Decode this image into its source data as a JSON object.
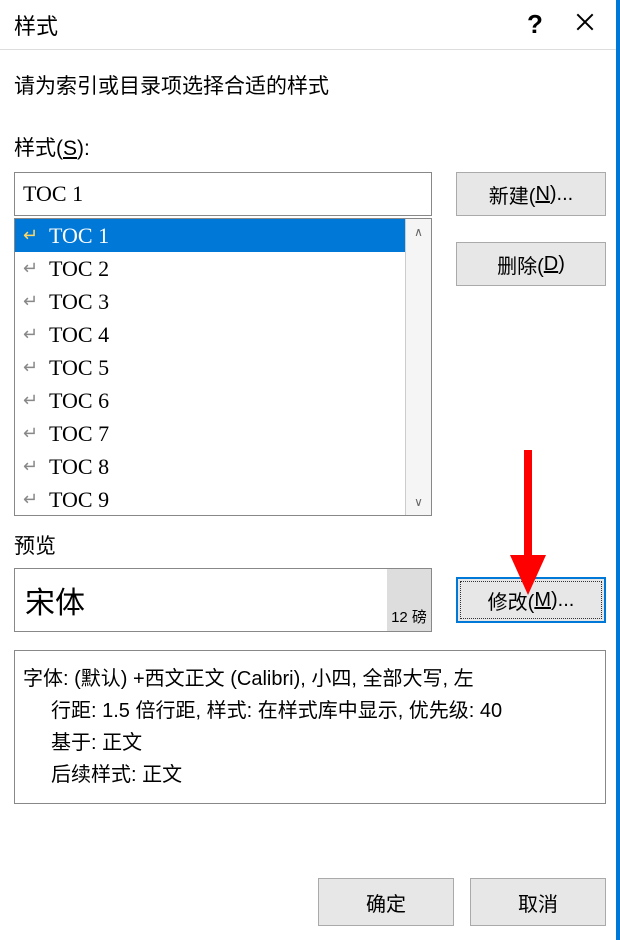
{
  "titlebar": {
    "title": "样式",
    "help": "?",
    "close": "×"
  },
  "instruction": "请为索引或目录项选择合适的样式",
  "stylesLabel": {
    "prefix": "样式(",
    "key": "S",
    "suffix": "):"
  },
  "currentStyle": "TOC 1",
  "styleList": [
    "TOC 1",
    "TOC 2",
    "TOC 3",
    "TOC 4",
    "TOC 5",
    "TOC 6",
    "TOC 7",
    "TOC 8",
    "TOC 9"
  ],
  "buttons": {
    "new": {
      "prefix": "新建(",
      "key": "N",
      "suffix": ")..."
    },
    "delete": {
      "prefix": "删除(",
      "key": "D",
      "suffix": ")"
    },
    "modify": {
      "prefix": "修改(",
      "key": "M",
      "suffix": ")..."
    },
    "ok": "确定",
    "cancel": "取消"
  },
  "previewLabel": "预览",
  "preview": {
    "fontName": "宋体",
    "size": "12 磅"
  },
  "description": {
    "line1": "字体: (默认) +西文正文 (Calibri), 小四, 全部大写, 左",
    "line2": "行距: 1.5 倍行距, 样式: 在样式库中显示, 优先级: 40",
    "line3": "基于: 正文",
    "line4": "后续样式: 正文"
  }
}
